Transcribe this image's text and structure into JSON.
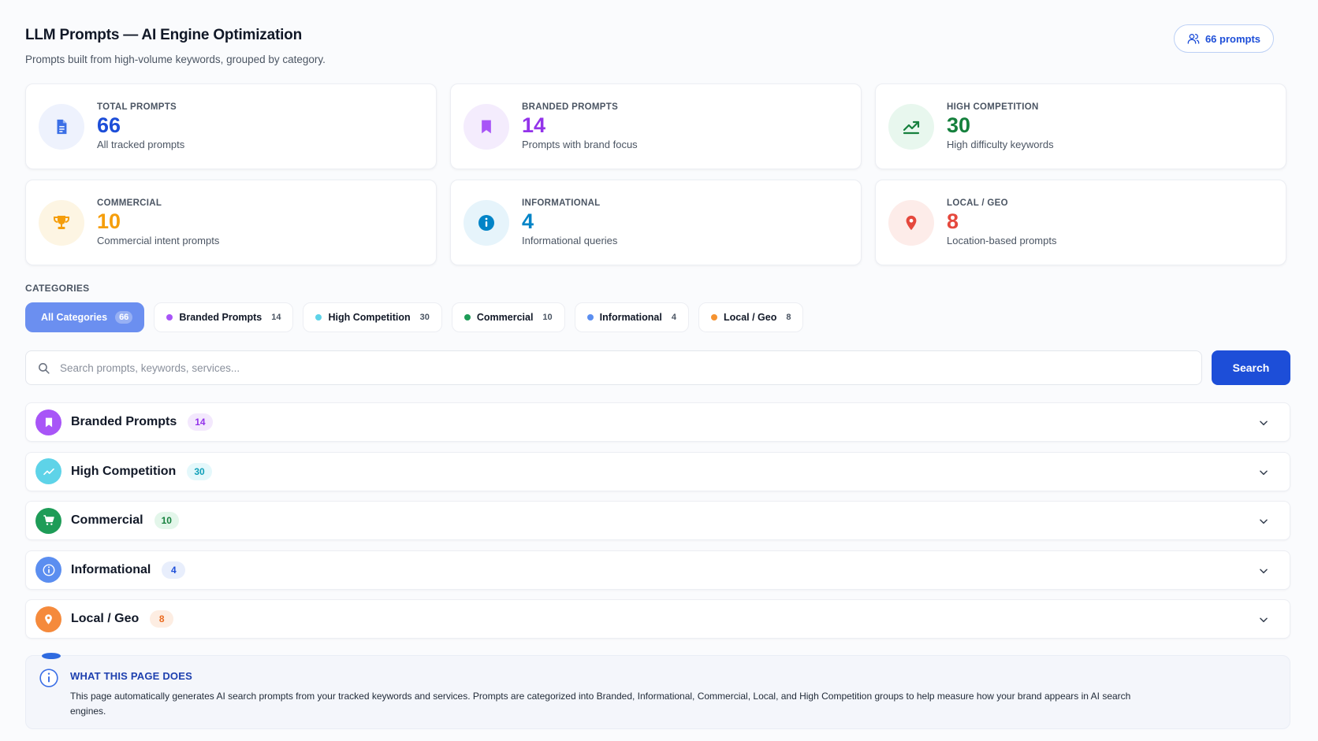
{
  "header": {
    "title": "LLM Prompts — AI Engine Optimization",
    "subtitle": "Prompts built from high-volume keywords, grouped by category.",
    "count_pill": "66 prompts"
  },
  "stats": [
    {
      "label": "TOTAL PROMPTS",
      "value": "66",
      "desc": "All tracked prompts",
      "icon": "document-icon",
      "color": "#1d4ed8",
      "bg": "#eef2fd"
    },
    {
      "label": "BRANDED PROMPTS",
      "value": "14",
      "desc": "Prompts with brand focus",
      "icon": "bookmark-icon",
      "color": "#9333ea",
      "bg": "#f4ecfd"
    },
    {
      "label": "HIGH COMPETITION",
      "value": "30",
      "desc": "High difficulty keywords",
      "icon": "trend-up-icon",
      "color": "#15803d",
      "bg": "#e8f7ee"
    },
    {
      "label": "COMMERCIAL",
      "value": "10",
      "desc": "Commercial intent prompts",
      "icon": "trophy-icon",
      "color": "#f59e0b",
      "bg": "#fdf5e3"
    },
    {
      "label": "INFORMATIONAL",
      "value": "4",
      "desc": "Informational queries",
      "icon": "info-icon",
      "color": "#0284c7",
      "bg": "#e6f4fb"
    },
    {
      "label": "LOCAL / GEO",
      "value": "8",
      "desc": "Location-based prompts",
      "icon": "map-pin-icon",
      "color": "#e5483d",
      "bg": "#fdece9"
    }
  ],
  "categories": {
    "title": "CATEGORIES",
    "chips": [
      {
        "label": "All Categories",
        "count": "66",
        "active": true
      },
      {
        "label": "Branded Prompts",
        "count": "14",
        "color": "#a855f7"
      },
      {
        "label": "High Competition",
        "count": "30",
        "color": "#5ed3e8"
      },
      {
        "label": "Commercial",
        "count": "10",
        "color": "#1e9c57"
      },
      {
        "label": "Informational",
        "count": "4",
        "color": "#5b8ef0"
      },
      {
        "label": "Local / Geo",
        "count": "8",
        "color": "#f59331"
      }
    ]
  },
  "search": {
    "placeholder": "Search prompts, keywords, services...",
    "value": "",
    "button_label": "Search"
  },
  "groups": [
    {
      "name": "Branded Prompts",
      "count": "14",
      "icon": "bookmark-icon",
      "color": "#a855f7",
      "badge_bg": "#f3e8fd",
      "badge_fg": "#9333ea"
    },
    {
      "name": "High Competition",
      "count": "30",
      "icon": "trend-up-icon",
      "color": "#5ed3e8",
      "badge_bg": "#e4f8fb",
      "badge_fg": "#0e9fb8"
    },
    {
      "name": "Commercial",
      "count": "10",
      "icon": "cart-icon",
      "color": "#1e9c57",
      "badge_bg": "#e3f6ea",
      "badge_fg": "#15803d"
    },
    {
      "name": "Informational",
      "count": "4",
      "icon": "info-icon",
      "color": "#5b8ef0",
      "badge_bg": "#e8eefc",
      "badge_fg": "#1d4ed8"
    },
    {
      "name": "Local / Geo",
      "count": "8",
      "icon": "map-pin-icon",
      "color": "#f58a3c",
      "badge_bg": "#fdede2",
      "badge_fg": "#ea6a1e"
    }
  ],
  "info": {
    "title": "WHAT THIS PAGE DOES",
    "text": "This page automatically generates AI search prompts from your tracked keywords and services. Prompts are categorized into Branded, Informational, Commercial, Local, and High Competition groups to help measure how your brand appears in AI search engines."
  }
}
